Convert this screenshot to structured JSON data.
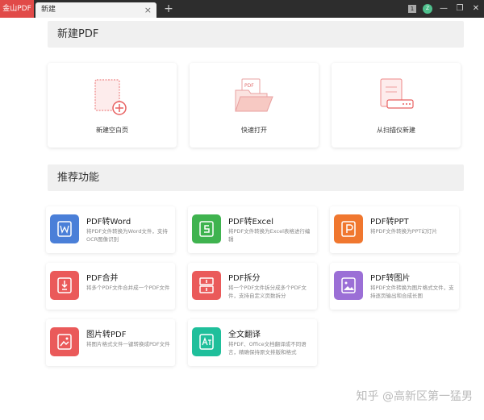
{
  "titlebar": {
    "app_tab": "金山PDF",
    "doc_tab": "新建",
    "close_glyph": "×",
    "new_tab_glyph": "+",
    "badge": "1",
    "avatar_text": "Z",
    "controls": [
      "—",
      "❐",
      "✕"
    ]
  },
  "sections": {
    "new_pdf": "新建PDF",
    "recommended": "推荐功能"
  },
  "big_cards": [
    {
      "label": "新建空白页",
      "icon": "blank-page-plus-icon"
    },
    {
      "label": "快速打开",
      "icon": "open-folder-icon"
    },
    {
      "label": "从扫描仪新建",
      "icon": "scanner-icon"
    }
  ],
  "features": [
    {
      "title": "PDF转Word",
      "desc": "将PDF文件转换为Word文件，支持OCR图像识别",
      "color": "#4a7fd8",
      "icon": "word-icon"
    },
    {
      "title": "PDF转Excel",
      "desc": "将PDF文件转换为Excel表格进行编辑",
      "color": "#3fb34f",
      "icon": "excel-icon"
    },
    {
      "title": "PDF转PPT",
      "desc": "将PDF文件转换为PPT幻灯片",
      "color": "#f0772f",
      "icon": "ppt-icon"
    },
    {
      "title": "PDF合并",
      "desc": "将多个PDF文件合并成一个PDF文件",
      "color": "#ea5a5a",
      "icon": "merge-icon"
    },
    {
      "title": "PDF拆分",
      "desc": "将一个PDF文件拆分成多个PDF文件，支持自定义页数拆分",
      "color": "#ea5a5a",
      "icon": "split-icon"
    },
    {
      "title": "PDF转图片",
      "desc": "将PDF文件转换为图片格式文件，支持逐页输出和合成长图",
      "color": "#9b6fd6",
      "icon": "image-icon"
    },
    {
      "title": "图片转PDF",
      "desc": "将图片格式文件一键转换成PDF文件",
      "color": "#ea5a5a",
      "icon": "image-to-pdf-icon"
    },
    {
      "title": "全文翻译",
      "desc": "将PDF、Office文档翻译成不同语言，精确保持原文排版和格式",
      "color": "#1fbf9b",
      "icon": "translate-icon"
    }
  ],
  "watermark": "知乎 @高新区第一猛男"
}
